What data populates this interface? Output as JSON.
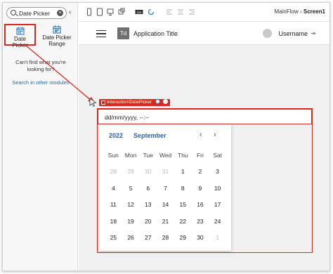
{
  "left_panel": {
    "search": {
      "value": "Date Picker"
    },
    "widgets": [
      {
        "label": "Date Picker",
        "icon": "calendar-icon",
        "selected": true
      },
      {
        "label": "Date Picker Range",
        "icon": "calendar-range-icon",
        "selected": false
      }
    ],
    "not_found_text": "Can't find what you're looking for?",
    "search_modules_link": "Search in other modules"
  },
  "toolbar": {
    "icons": [
      "phone-icon",
      "tablet-icon",
      "desktop-icon",
      "multi-device-icon",
      "code-icon",
      "refresh-icon",
      "align-left-icon",
      "align-center-icon",
      "align-right-icon"
    ],
    "breadcrumb_flow": "MainFlow",
    "breadcrumb_sep": "›",
    "breadcrumb_screen": "Screen1"
  },
  "app": {
    "logo_text": "Td",
    "title": "Application Title",
    "username": "Username"
  },
  "widget": {
    "tag_label": "Interaction\\DatePicker",
    "input_value": "dd/mm/yyyy, --:--"
  },
  "calendar": {
    "year": "2022",
    "month": "September",
    "weekdays": [
      "Sun",
      "Mon",
      "Tue",
      "Wed",
      "Thu",
      "Fri",
      "Sat"
    ],
    "weeks": [
      [
        {
          "d": "28",
          "m": 1
        },
        {
          "d": "29",
          "m": 1
        },
        {
          "d": "30",
          "m": 1
        },
        {
          "d": "31",
          "m": 1
        },
        {
          "d": "1",
          "m": 0
        },
        {
          "d": "2",
          "m": 0
        },
        {
          "d": "3",
          "m": 0
        }
      ],
      [
        {
          "d": "4",
          "m": 0
        },
        {
          "d": "5",
          "m": 0
        },
        {
          "d": "6",
          "m": 0
        },
        {
          "d": "7",
          "m": 0
        },
        {
          "d": "8",
          "m": 0
        },
        {
          "d": "9",
          "m": 0
        },
        {
          "d": "10",
          "m": 0
        }
      ],
      [
        {
          "d": "11",
          "m": 0
        },
        {
          "d": "12",
          "m": 0
        },
        {
          "d": "13",
          "m": 0
        },
        {
          "d": "14",
          "m": 0
        },
        {
          "d": "15",
          "m": 0
        },
        {
          "d": "16",
          "m": 0
        },
        {
          "d": "17",
          "m": 0
        }
      ],
      [
        {
          "d": "18",
          "m": 0
        },
        {
          "d": "19",
          "m": 0
        },
        {
          "d": "20",
          "m": 0
        },
        {
          "d": "21",
          "m": 0
        },
        {
          "d": "22",
          "m": 0
        },
        {
          "d": "23",
          "m": 0
        },
        {
          "d": "24",
          "m": 0
        }
      ],
      [
        {
          "d": "25",
          "m": 0
        },
        {
          "d": "26",
          "m": 0
        },
        {
          "d": "27",
          "m": 0
        },
        {
          "d": "28",
          "m": 0
        },
        {
          "d": "29",
          "m": 0
        },
        {
          "d": "30",
          "m": 0
        },
        {
          "d": "1",
          "m": 1
        }
      ]
    ]
  },
  "colors": {
    "accent": "#d9291c",
    "link": "#1e6bb8",
    "calendar_header": "#2a5fc4"
  }
}
